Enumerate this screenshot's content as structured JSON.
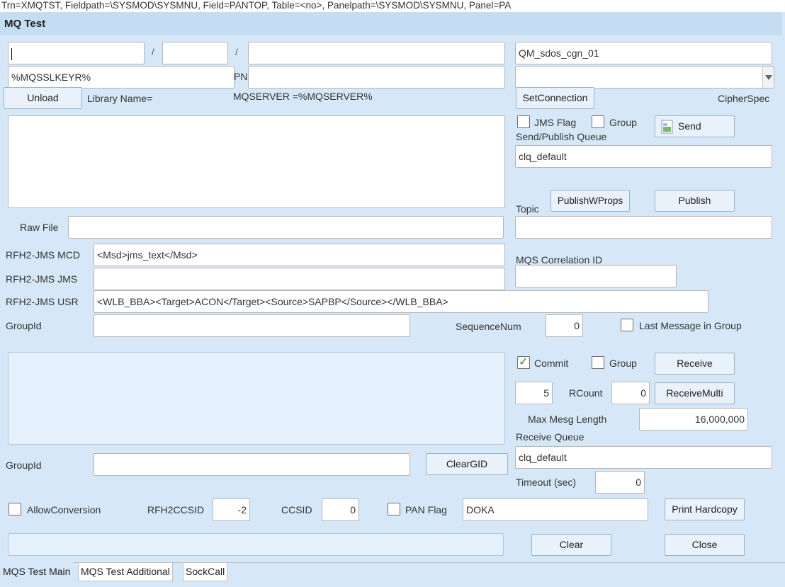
{
  "status_bar": {
    "text": "Trn=XMQTST, Fieldpath=\\SYSMOD\\SYSMNU, Field=PANTOP, Table=<no>, Panelpath=\\SYSMOD\\SYSMNU, Panel=PA"
  },
  "window": {
    "title": "MQ Test"
  },
  "top": {
    "field1": "",
    "slash1": "/",
    "field2": "",
    "slash2": "/",
    "field3": "",
    "ssl_key": "%MQSSLKEYR%",
    "pn_label": "PN",
    "pn_value": "",
    "queue_manager": "QM_sdos_cgn_01",
    "cipherspec_value": "",
    "unload_btn": "Unload",
    "library_label": "Library Name=",
    "mqserver_label": "MQSERVER =%MQSERVER%",
    "setconnection_btn": "SetConnection",
    "cipherspec_label": "CipherSpec"
  },
  "send": {
    "jms_flag_label": "JMS Flag",
    "group_label": "Group",
    "send_btn": "Send",
    "queue_label": "Send/Publish Queue",
    "queue_value": "clq_default",
    "topic_label": "Topic",
    "publishwprops_btn": "PublishWProps",
    "publish_btn": "Publish",
    "topic_value": "",
    "correlation_label": "MQS Correlation ID",
    "correlation_value": ""
  },
  "raw": {
    "label": "Raw File",
    "value": ""
  },
  "rfh2": {
    "mcd_label": "RFH2-JMS MCD",
    "mcd_value": "<Msd>jms_text</Msd>",
    "jms_label": "RFH2-JMS JMS",
    "jms_value": "",
    "usr_label": "RFH2-JMS USR",
    "usr_value": "<WLB_BBA><Target>ACON</Target><Source>SAPBP</Source></WLB_BBA>",
    "groupid_label": "GroupId",
    "groupid_value": "",
    "seqnum_label": "SequenceNum",
    "seqnum_value": "0",
    "last_msg_label": "Last Message in Group"
  },
  "receive": {
    "commit_label": "Commit",
    "group_label": "Group",
    "receive_btn": "Receive",
    "count_value": "5",
    "rcount_label": "RCount",
    "rcount_value": "0",
    "receivemulti_btn": "ReceiveMulti",
    "maxlen_label": "Max Mesg Length",
    "maxlen_value": "16,000,000",
    "queue_label": "Receive Queue",
    "queue_value": "clq_default",
    "groupid_label": "GroupId",
    "groupid_value": "",
    "cleargid_btn": "ClearGID",
    "timeout_label": "Timeout (sec)",
    "timeout_value": "0"
  },
  "bottom": {
    "allowconv_label": "AllowConversion",
    "rfh2ccsid_label": "RFH2CCSID",
    "rfh2ccsid_value": "-2",
    "ccsid_label": "CCSID",
    "ccsid_value": "0",
    "panflag_label": "PAN Flag",
    "panflag_value": "DOKA",
    "print_btn": "Print Hardcopy",
    "status_value": "",
    "clear_btn": "Clear",
    "close_btn": "Close"
  },
  "tabs": [
    {
      "label": "MQS Test Main",
      "active": true
    },
    {
      "label": "MQS Test Additional",
      "active": false
    },
    {
      "label": "SockCall",
      "active": false
    }
  ],
  "checkboxes": {
    "jms_flag": false,
    "send_group": false,
    "last_msg": false,
    "commit": true,
    "recv_group": false,
    "allow_conversion": false,
    "pan_flag": false
  },
  "colors": {
    "background": "#d6e8f8",
    "titlebar": "#c5ddf3",
    "check": "#2b8a2b"
  }
}
